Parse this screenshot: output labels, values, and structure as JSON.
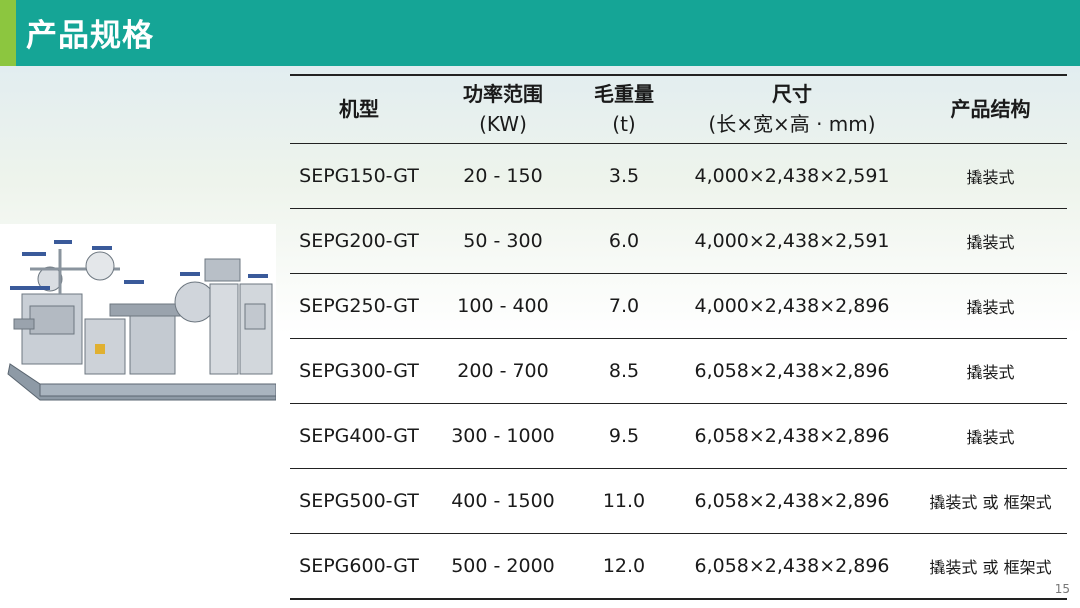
{
  "header": {
    "title": "产品规格"
  },
  "table": {
    "columns": [
      {
        "title": "机型",
        "unit": ""
      },
      {
        "title": "功率范围",
        "unit": "(KW)"
      },
      {
        "title": "毛重量",
        "unit": "(t)"
      },
      {
        "title": "尺寸",
        "unit": "(长×宽×高 · mm)"
      },
      {
        "title": "产品结构",
        "unit": ""
      }
    ],
    "rows": [
      {
        "model": "SEPG150-GT",
        "power": "20 - 150",
        "weight": "3.5",
        "size": "4,000×2,438×2,591",
        "structure": "撬装式"
      },
      {
        "model": "SEPG200-GT",
        "power": "50 - 300",
        "weight": "6.0",
        "size": "4,000×2,438×2,591",
        "structure": "撬装式"
      },
      {
        "model": "SEPG250-GT",
        "power": "100 - 400",
        "weight": "7.0",
        "size": "4,000×2,438×2,896",
        "structure": "撬装式"
      },
      {
        "model": "SEPG300-GT",
        "power": "200 - 700",
        "weight": "8.5",
        "size": "6,058×2,438×2,896",
        "structure": "撬装式"
      },
      {
        "model": "SEPG400-GT",
        "power": "300 - 1000",
        "weight": "9.5",
        "size": "6,058×2,438×2,896",
        "structure": "撬装式"
      },
      {
        "model": "SEPG500-GT",
        "power": "400 - 1500",
        "weight": "11.0",
        "size": "6,058×2,438×2,896",
        "structure": "撬装式 或 框架式"
      },
      {
        "model": "SEPG600-GT",
        "power": "500 - 2000",
        "weight": "12.0",
        "size": "6,058×2,438×2,896",
        "structure": "撬装式 或 框架式"
      }
    ]
  },
  "page": {
    "number": "15"
  },
  "colors": {
    "header": "#15a596",
    "accent": "#8cc63f"
  },
  "image": {
    "icon": "skid-mounted-generator-set-diagram"
  }
}
